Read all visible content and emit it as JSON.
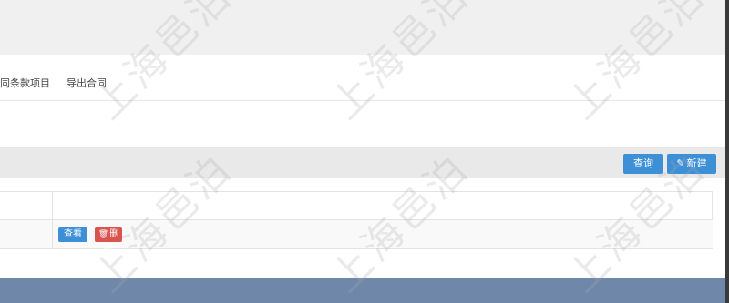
{
  "tabs": [
    "同条款项目",
    "导出合同"
  ],
  "toolbar": {
    "query_label": "查询",
    "new_label": "新建"
  },
  "row": {
    "view_label": "查看",
    "delete_label": "删除"
  },
  "watermark": "上海邑泊",
  "icons": {
    "pencil": "pencil-icon",
    "trash": "trash-icon"
  },
  "colors": {
    "primary": "#3d8fd6",
    "danger": "#d9534f",
    "footer": "#6f87a8"
  }
}
